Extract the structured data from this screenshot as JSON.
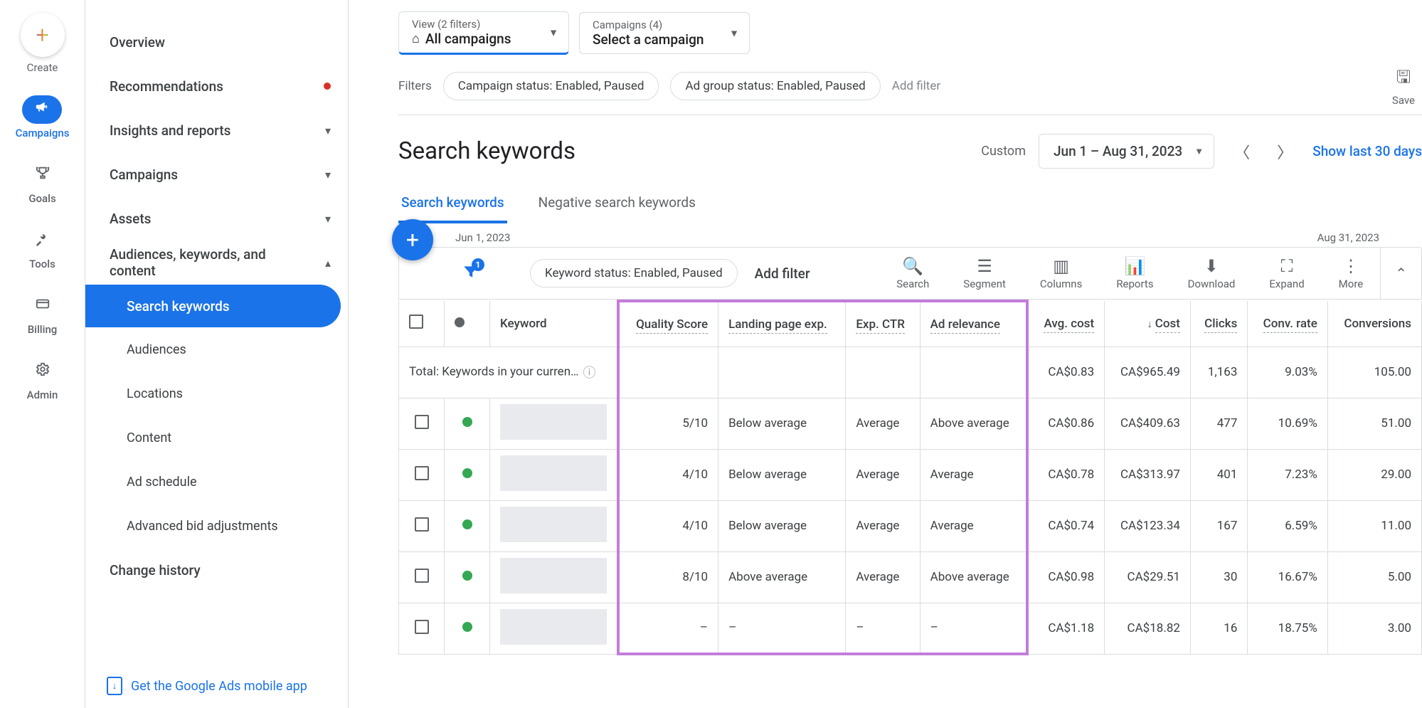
{
  "leftRail": {
    "create": "Create",
    "items": [
      {
        "label": "Campaigns",
        "icon": "📢",
        "active": true
      },
      {
        "label": "Goals",
        "icon": "🏆"
      },
      {
        "label": "Tools",
        "icon": "🛠"
      },
      {
        "label": "Billing",
        "icon": "💳"
      },
      {
        "label": "Admin",
        "icon": "⚙"
      }
    ]
  },
  "sideNav": {
    "items": [
      {
        "label": "Overview",
        "type": "simple"
      },
      {
        "label": "Recommendations",
        "type": "alert"
      },
      {
        "label": "Insights and reports",
        "type": "expandable"
      },
      {
        "label": "Campaigns",
        "type": "expandable"
      },
      {
        "label": "Assets",
        "type": "expandable"
      },
      {
        "label": "Audiences, keywords, and content",
        "type": "expanded"
      },
      {
        "label": "Search keywords",
        "type": "sub",
        "active": true
      },
      {
        "label": "Audiences",
        "type": "sub"
      },
      {
        "label": "Locations",
        "type": "sub"
      },
      {
        "label": "Content",
        "type": "sub"
      },
      {
        "label": "Ad schedule",
        "type": "sub"
      },
      {
        "label": "Advanced bid adjustments",
        "type": "sub"
      },
      {
        "label": "Change history",
        "type": "simple"
      }
    ],
    "mobileApp": "Get the Google Ads mobile app"
  },
  "topSelectors": {
    "view": {
      "label": "View (2 filters)",
      "value": "All campaigns"
    },
    "campaign": {
      "label": "Campaigns (4)",
      "value": "Select a campaign"
    }
  },
  "filtersRow": {
    "label": "Filters",
    "chips": [
      "Campaign status: Enabled, Paused",
      "Ad group status: Enabled, Paused"
    ],
    "addFilter": "Add filter",
    "save": "Save"
  },
  "headingRow": {
    "title": "Search keywords",
    "customLabel": "Custom",
    "dateRange": "Jun 1 – Aug 31, 2023",
    "showLast": "Show last 30 days"
  },
  "tabs": [
    {
      "label": "Search keywords",
      "active": true
    },
    {
      "label": "Negative search keywords"
    }
  ],
  "miniDates": {
    "start": "Jun 1, 2023",
    "end": "Aug 31, 2023"
  },
  "toolbar": {
    "filterBadge": "1",
    "kwStatusChip": "Keyword status: Enabled, Paused",
    "addFilter": "Add filter",
    "actions": [
      {
        "label": "Search",
        "icon": "🔍"
      },
      {
        "label": "Segment",
        "icon": "≡"
      },
      {
        "label": "Columns",
        "icon": "▥"
      },
      {
        "label": "Reports",
        "icon": "📊"
      },
      {
        "label": "Download",
        "icon": "⬇"
      },
      {
        "label": "Expand",
        "icon": "⛶"
      },
      {
        "label": "More",
        "icon": "⋮"
      }
    ]
  },
  "table": {
    "headers": {
      "keyword": "Keyword",
      "quality": "Quality Score",
      "lpe": "Landing page exp.",
      "expctr": "Exp. CTR",
      "adrel": "Ad relevance",
      "avgcost": "Avg. cost",
      "cost": "Cost",
      "clicks": "Clicks",
      "convrate": "Conv. rate",
      "conversions": "Conversions"
    },
    "totalLabel": "Total: Keywords in your curren…",
    "totalRow": {
      "avgcost": "CA$0.83",
      "cost": "CA$965.49",
      "clicks": "1,163",
      "convrate": "9.03%",
      "conversions": "105.00"
    },
    "rows": [
      {
        "quality": "5/10",
        "lpe": "Below average",
        "expctr": "Average",
        "adrel": "Above average",
        "avgcost": "CA$0.86",
        "cost": "CA$409.63",
        "clicks": "477",
        "convrate": "10.69%",
        "conversions": "51.00"
      },
      {
        "quality": "4/10",
        "lpe": "Below average",
        "expctr": "Average",
        "adrel": "Average",
        "avgcost": "CA$0.78",
        "cost": "CA$313.97",
        "clicks": "401",
        "convrate": "7.23%",
        "conversions": "29.00"
      },
      {
        "quality": "4/10",
        "lpe": "Below average",
        "expctr": "Average",
        "adrel": "Average",
        "avgcost": "CA$0.74",
        "cost": "CA$123.34",
        "clicks": "167",
        "convrate": "6.59%",
        "conversions": "11.00"
      },
      {
        "quality": "8/10",
        "lpe": "Above average",
        "expctr": "Average",
        "adrel": "Above average",
        "avgcost": "CA$0.98",
        "cost": "CA$29.51",
        "clicks": "30",
        "convrate": "16.67%",
        "conversions": "5.00"
      },
      {
        "quality": "–",
        "lpe": "–",
        "expctr": "–",
        "adrel": "–",
        "avgcost": "CA$1.18",
        "cost": "CA$18.82",
        "clicks": "16",
        "convrate": "18.75%",
        "conversions": "3.00"
      }
    ]
  }
}
